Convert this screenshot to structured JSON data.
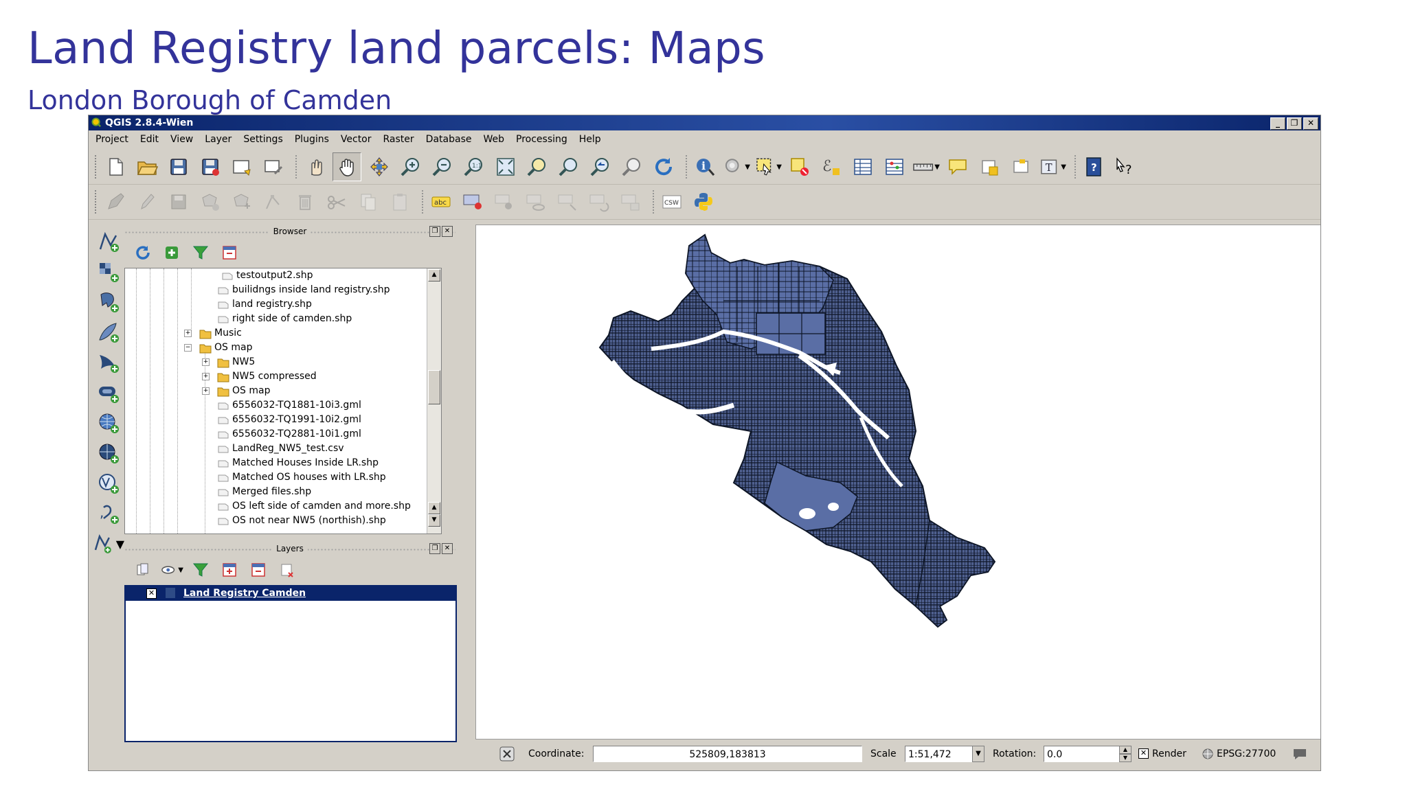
{
  "slide": {
    "title": "Land Registry land parcels: Maps",
    "subtitle": "London Borough of Camden"
  },
  "window": {
    "title": "QGIS 2.8.4-Wien",
    "buttons": {
      "minimize": "_",
      "restore": "❐",
      "close": "✕"
    }
  },
  "menu": [
    "Project",
    "Edit",
    "View",
    "Layer",
    "Settings",
    "Plugins",
    "Vector",
    "Raster",
    "Database",
    "Web",
    "Processing",
    "Help"
  ],
  "toolbar": {
    "csw_label": "CSW",
    "label_tool_text": "abc",
    "help_text": "?"
  },
  "browser": {
    "title": "Browser",
    "items": [
      {
        "label": "testoutput2.shp",
        "type": "file"
      },
      {
        "label": "builidngs inside land registry.shp",
        "type": "file"
      },
      {
        "label": "land registry.shp",
        "type": "file"
      },
      {
        "label": "right side of camden.shp",
        "type": "file"
      },
      {
        "label": "Music",
        "type": "folder"
      },
      {
        "label": "OS map",
        "type": "folder"
      },
      {
        "label": "NW5",
        "type": "folder"
      },
      {
        "label": "NW5 compressed",
        "type": "folder"
      },
      {
        "label": "OS map",
        "type": "folder"
      },
      {
        "label": "6556032-TQ1881-10i3.gml",
        "type": "file"
      },
      {
        "label": "6556032-TQ1991-10i2.gml",
        "type": "file"
      },
      {
        "label": "6556032-TQ2881-10i1.gml",
        "type": "file"
      },
      {
        "label": "LandReg_NW5_test.csv",
        "type": "file"
      },
      {
        "label": "Matched Houses Inside LR.shp",
        "type": "file"
      },
      {
        "label": "Matched OS houses with LR.shp",
        "type": "file"
      },
      {
        "label": "Merged files.shp",
        "type": "file"
      },
      {
        "label": "OS left side of camden and more.shp",
        "type": "file"
      },
      {
        "label": "OS not near NW5 (northish).shp",
        "type": "file"
      }
    ]
  },
  "layers": {
    "title": "Layers",
    "items": [
      {
        "label": "Land Registry Camden",
        "checked": true,
        "color": "#2e4b86"
      }
    ]
  },
  "status": {
    "coordinate_label": "Coordinate:",
    "coordinate_value": "525809,183813",
    "scale_label": "Scale",
    "scale_value": "1:51,472",
    "rotation_label": "Rotation:",
    "rotation_value": "0.0",
    "render_label": "Render",
    "render_checked": true,
    "crs": "EPSG:27700"
  },
  "colors": {
    "slide_text": "#33339a",
    "parcel_fill": "#5a6ea5",
    "parcel_outline": "#0d1526",
    "titlebar": "#0a246a",
    "window_bg": "#d4d0c8"
  }
}
